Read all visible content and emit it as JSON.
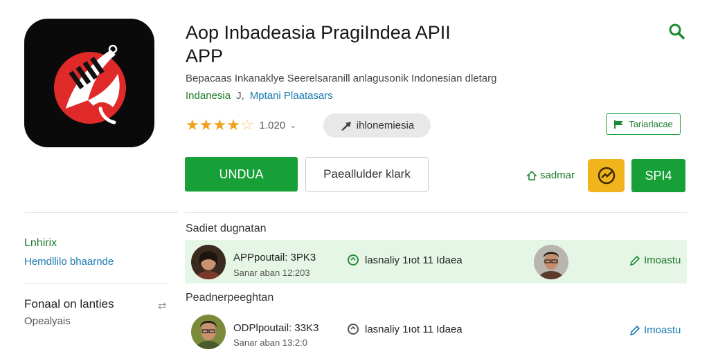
{
  "app": {
    "title_line1": "Aop Inbadeasia PragiIndea APII",
    "title_line2": "APP",
    "description": "Bepacaas Inkanaklye Seerelsaranill anlagusonik Indonesian dletarg",
    "category_primary": "Indanesia",
    "category_separator": "J,",
    "category_secondary": "Mptani Plaatasars",
    "rating_count": "1.020",
    "pill_label": "ihlonemiesia",
    "top_action_label": "Tariarlacae"
  },
  "actions": {
    "install_label": "UNDUA",
    "secondary_label": "Paeallulder klark",
    "wishlist_label": "sadmar",
    "share_label": "SPI4"
  },
  "sidebar": {
    "heading": "Lnhirix",
    "link": "Hemdllilo bhaarnde",
    "section_title": "Fonaal on lanties",
    "section_subtitle": "Opealyais"
  },
  "sections": [
    {
      "title": "Sadiet dugnatan",
      "row": {
        "name": "APPpoutail: 3PK3",
        "date": "Sanar aban 12:203",
        "message": "lasnaliy 1ıot 11 Idaea",
        "action": "Imoastu"
      }
    },
    {
      "title": "Peadnerpeeghtan",
      "row": {
        "name": "ODPlpoutail: 33K3",
        "date": "Sanar aban 13:2:0",
        "message": "lasnaliy 1ıot 11 Idaea",
        "action": "Imoastu"
      }
    }
  ],
  "colors": {
    "accent_green": "#18a038",
    "link_blue": "#1a7ab0",
    "star": "#f2a01f",
    "badge_yellow": "#f1b41c",
    "icon_red": "#e02a2a"
  },
  "icons": [
    "app-logo-icon",
    "search-icon",
    "star-icon",
    "chevron-down-icon",
    "share-arrow-icon",
    "flag-icon",
    "home-icon",
    "emoji-badge-icon",
    "link-icon",
    "edit-pencil-icon",
    "drag-handle-icon"
  ]
}
